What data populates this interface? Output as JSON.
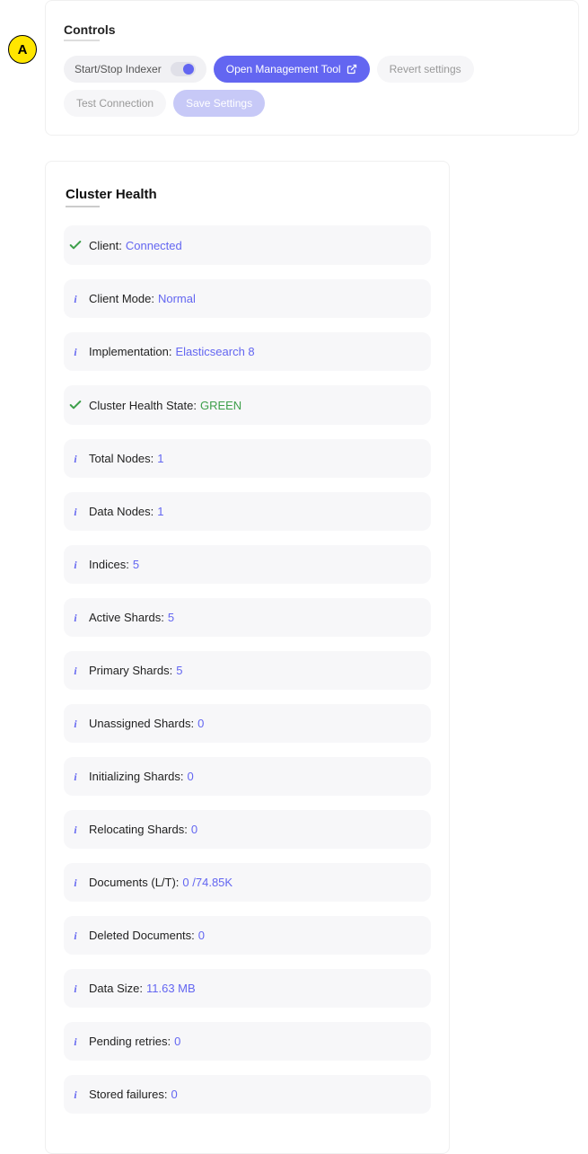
{
  "marker": "A",
  "controls": {
    "title": "Controls",
    "toggle_label": "Start/Stop Indexer",
    "open_tool_label": "Open Management Tool",
    "revert_label": "Revert settings",
    "test_label": "Test Connection",
    "save_label": "Save Settings"
  },
  "health": {
    "title": "Cluster Health",
    "items": [
      {
        "icon": "check",
        "label": "Client:",
        "value": "Connected",
        "value_class": ""
      },
      {
        "icon": "info",
        "label": "Client Mode:",
        "value": "Normal",
        "value_class": ""
      },
      {
        "icon": "info",
        "label": "Implementation:",
        "value": "Elasticsearch 8",
        "value_class": ""
      },
      {
        "icon": "check",
        "label": "Cluster Health State:",
        "value": "GREEN",
        "value_class": "green"
      },
      {
        "icon": "info",
        "label": "Total Nodes:",
        "value": "1",
        "value_class": ""
      },
      {
        "icon": "info",
        "label": "Data Nodes:",
        "value": "1",
        "value_class": ""
      },
      {
        "icon": "info",
        "label": "Indices:",
        "value": "5",
        "value_class": ""
      },
      {
        "icon": "info",
        "label": "Active Shards:",
        "value": "5",
        "value_class": ""
      },
      {
        "icon": "info",
        "label": "Primary Shards:",
        "value": "5",
        "value_class": ""
      },
      {
        "icon": "info",
        "label": "Unassigned Shards:",
        "value": "0",
        "value_class": ""
      },
      {
        "icon": "info",
        "label": "Initializing Shards:",
        "value": "0",
        "value_class": ""
      },
      {
        "icon": "info",
        "label": "Relocating Shards:",
        "value": "0",
        "value_class": ""
      },
      {
        "icon": "info",
        "label": "Documents (L/T):",
        "value": "0 /74.85K",
        "value_class": ""
      },
      {
        "icon": "info",
        "label": "Deleted Documents:",
        "value": "0",
        "value_class": ""
      },
      {
        "icon": "info",
        "label": "Data Size:",
        "value": "11.63 MB",
        "value_class": ""
      },
      {
        "icon": "info",
        "label": "Pending retries:",
        "value": "0",
        "value_class": ""
      },
      {
        "icon": "info",
        "label": "Stored failures:",
        "value": "0",
        "value_class": ""
      }
    ]
  }
}
